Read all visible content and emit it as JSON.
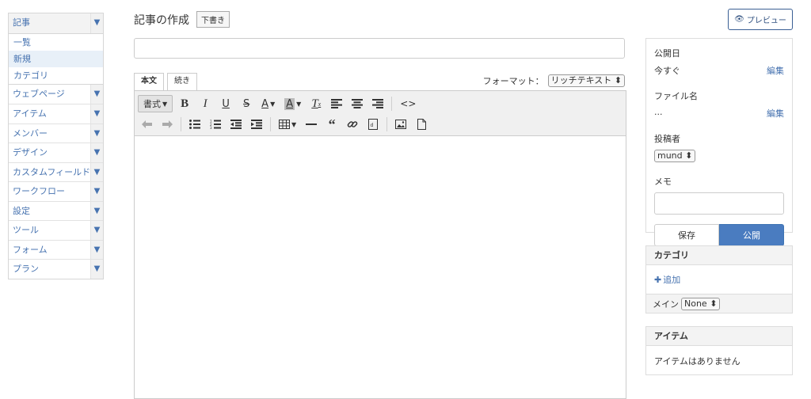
{
  "sidebar": {
    "article_label": "記事",
    "article_sub": [
      "一覧",
      "新規",
      "カテゴリ"
    ],
    "items": [
      "ウェブページ",
      "アイテム",
      "メンバー",
      "デザイン",
      "カスタムフィールド",
      "ワークフロー",
      "設定",
      "ツール",
      "フォーム",
      "プラン"
    ],
    "arrow": "▼"
  },
  "main": {
    "page_title": "記事の作成",
    "draft_badge": "下書き",
    "tabs": [
      "本文",
      "続き"
    ],
    "format_label": "フォーマット：",
    "format_value": "リッチテキスト ⬍",
    "toolbar": {
      "style_label": "書式"
    }
  },
  "right": {
    "preview_label": "プレビュー",
    "publish_date_label": "公開日",
    "publish_date_value": "今すぐ",
    "edit_label": "編集",
    "filename_label": "ファイル名",
    "filename_value": "...",
    "author_label": "投稿者",
    "author_value": "mund ⬍",
    "memo_label": "メモ",
    "save_label": "保存",
    "publish_label": "公開",
    "category_title": "カテゴリ",
    "add_label": "追加",
    "main_cat_label": "メイン",
    "main_cat_value": "None ⬍",
    "items_title": "アイテム",
    "items_empty": "アイテムはありません"
  },
  "colors": {
    "link": "#4773b0",
    "primary": "#4a7cc0",
    "active_sub_bg": "#e8f0f8"
  }
}
